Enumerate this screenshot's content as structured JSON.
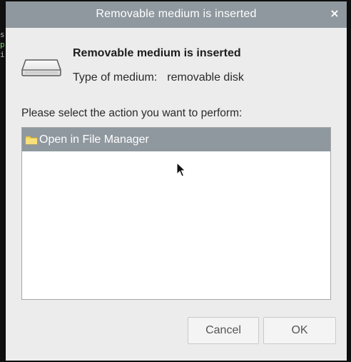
{
  "background": {
    "terminal_fragment": [
      "s",
      "p",
      "i"
    ]
  },
  "dialog": {
    "title": "Removable medium is inserted",
    "close_glyph": "×",
    "heading": "Removable medium is inserted",
    "medium_type_label": "Type of medium:",
    "medium_type_value": "removable disk",
    "prompt": "Please select the action you want to perform:",
    "actions": [
      {
        "label": "Open in File Manager",
        "icon": "folder-icon",
        "selected": true
      }
    ],
    "buttons": {
      "cancel": "Cancel",
      "ok": "OK"
    }
  },
  "colors": {
    "titlebar": "#8f989f",
    "selection": "#8f989f",
    "dialog_bg": "#ececec",
    "list_bg": "#ffffff",
    "folder": "#f2d45c"
  }
}
